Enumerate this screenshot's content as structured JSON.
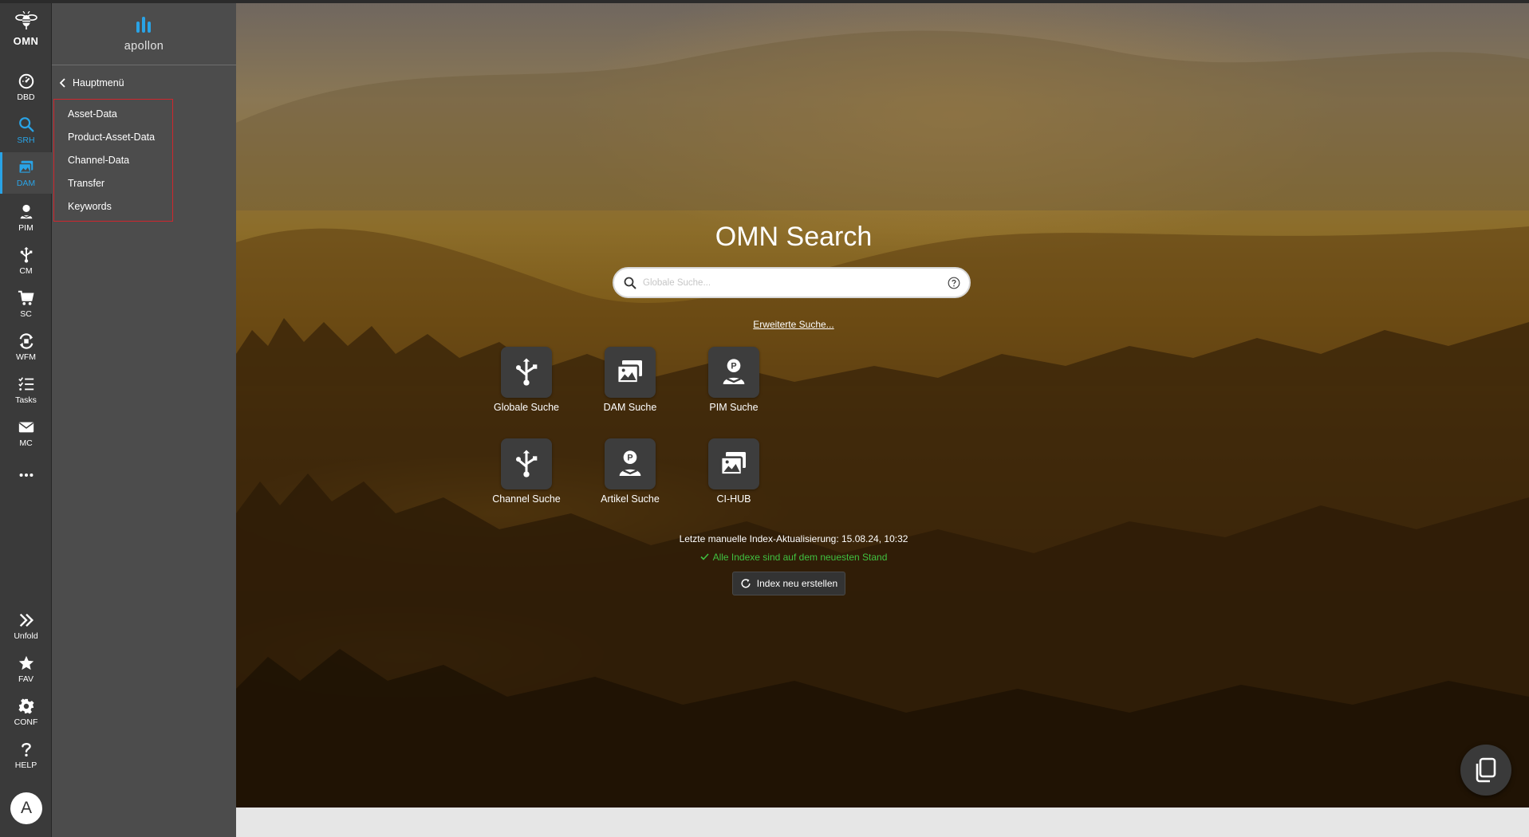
{
  "rail": {
    "logo": "OMN",
    "items": [
      {
        "label": "DBD",
        "icon": "dashboard-icon"
      },
      {
        "label": "SRH",
        "icon": "search-icon"
      },
      {
        "label": "DAM",
        "icon": "dam-images-icon"
      },
      {
        "label": "PIM",
        "icon": "pim-icon"
      },
      {
        "label": "CM",
        "icon": "channel-icon"
      },
      {
        "label": "SC",
        "icon": "cart-icon"
      },
      {
        "label": "WFM",
        "icon": "workflow-icon"
      },
      {
        "label": "Tasks",
        "icon": "tasks-icon"
      },
      {
        "label": "MC",
        "icon": "mail-icon"
      }
    ],
    "more_icon": "ellipsis-icon",
    "bottom_items": [
      {
        "label": "Unfold",
        "icon": "double-chevron-right-icon"
      },
      {
        "label": "FAV",
        "icon": "star-icon"
      },
      {
        "label": "CONF",
        "icon": "gear-icon"
      },
      {
        "label": "HELP",
        "icon": "question-icon"
      }
    ],
    "avatar": "A"
  },
  "subnav": {
    "brand": "apollon",
    "back_label": "Hauptmenü",
    "items": [
      "Asset-Data",
      "Product-Asset-Data",
      "Channel-Data",
      "Transfer",
      "Keywords"
    ]
  },
  "main": {
    "title": "OMN Search",
    "search": {
      "placeholder": "Globale Suche...",
      "value": ""
    },
    "advanced_link": "Erweiterte Suche...",
    "tiles": [
      {
        "label": "Globale Suche",
        "icon": "channel-icon"
      },
      {
        "label": "DAM Suche",
        "icon": "dam-images-icon"
      },
      {
        "label": "PIM Suche",
        "icon": "pim-icon"
      },
      {
        "label": "Channel Suche",
        "icon": "channel-icon"
      },
      {
        "label": "Artikel Suche",
        "icon": "pim-icon"
      },
      {
        "label": "CI-HUB",
        "icon": "dam-images-icon"
      }
    ],
    "index_info": "Letzte manuelle Index-Aktualisierung: 15.08.24, 10:32",
    "index_status": "Alle Indexe sind auf dem neuesten Stand",
    "reindex_label": "Index neu erstellen"
  },
  "colors": {
    "rail_bg": "#3a3a3a",
    "subnav_bg": "#4c4c4c",
    "accent": "#29a3e6",
    "highlight_border": "#d0262d",
    "status_ok": "#40c040"
  }
}
